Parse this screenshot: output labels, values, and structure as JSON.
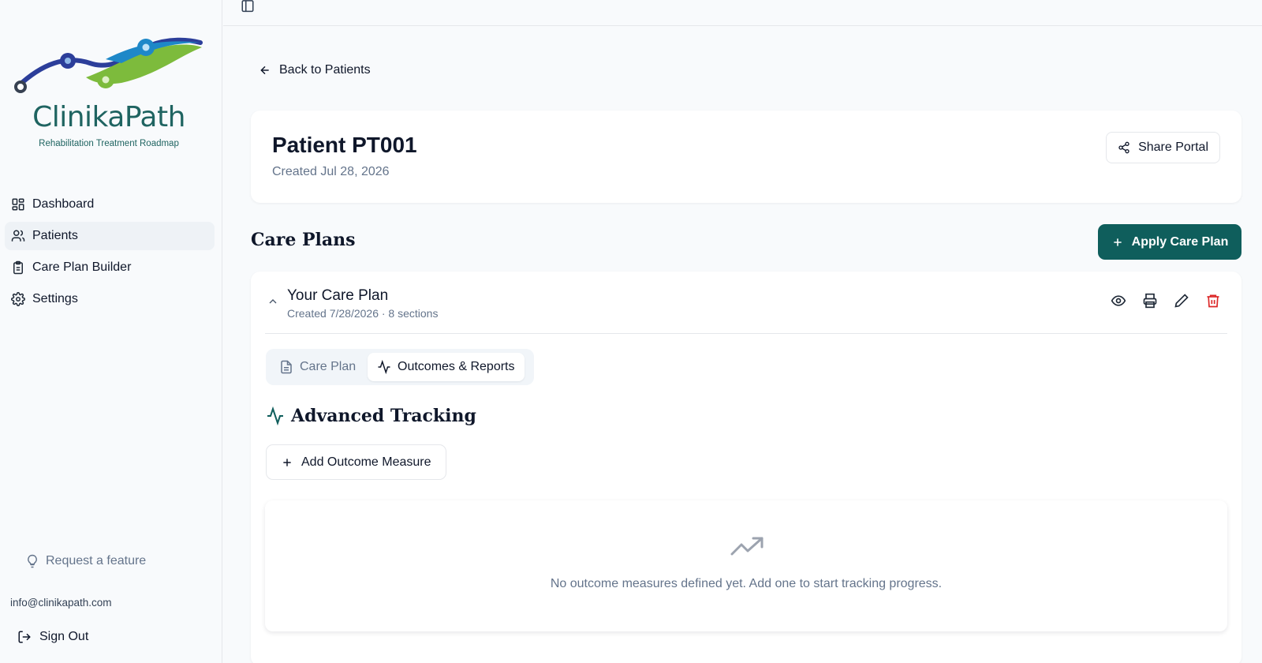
{
  "brand": {
    "name": "ClinikaPath",
    "tagline": "Rehabilitation Treatment Roadmap",
    "colors": {
      "teal": "#1f6461",
      "blue": "#1e88c8",
      "green": "#7dbb3c",
      "navy": "#2c3e9a"
    }
  },
  "sidebar": {
    "items": [
      {
        "label": "Dashboard",
        "icon": "dashboard-icon"
      },
      {
        "label": "Patients",
        "icon": "users-icon",
        "active": true
      },
      {
        "label": "Care Plan Builder",
        "icon": "clipboard-icon"
      },
      {
        "label": "Settings",
        "icon": "gear-icon"
      }
    ],
    "request_feature": "Request a feature",
    "email": "info@clinikapath.com",
    "sign_out": "Sign Out"
  },
  "nav": {
    "back_label": "Back to Patients"
  },
  "patient": {
    "title": "Patient PT001",
    "created": "Created Jul 28, 2026",
    "share_label": "Share Portal"
  },
  "care_plans": {
    "title": "Care Plans",
    "apply_label": "Apply Care Plan",
    "plan": {
      "title": "Your Care Plan",
      "meta": "Created 7/28/2026 · 8 sections",
      "tabs": [
        {
          "label": "Care Plan",
          "active": false
        },
        {
          "label": "Outcomes & Reports",
          "active": true
        }
      ],
      "advanced_title": "Advanced Tracking",
      "add_measure_label": "Add Outcome Measure",
      "empty_text": "No outcome measures defined yet. Add one to start tracking progress."
    }
  },
  "colors": {
    "primary": "#0f5e5c",
    "danger": "#dc2626",
    "muted": "#64748b"
  }
}
